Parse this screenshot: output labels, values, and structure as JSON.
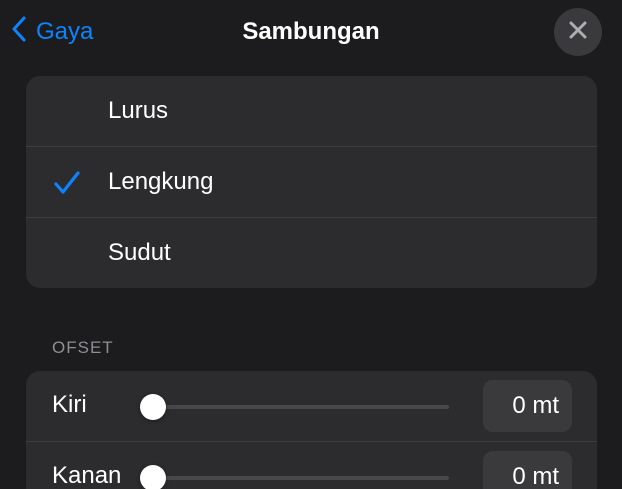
{
  "header": {
    "back_label": "Gaya",
    "title": "Sambungan",
    "close_icon": "close-icon"
  },
  "options": {
    "items": [
      {
        "label": "Lurus",
        "selected": false
      },
      {
        "label": "Lengkung",
        "selected": true
      },
      {
        "label": "Sudut",
        "selected": false
      }
    ]
  },
  "offset": {
    "section_label": "OFSET",
    "rows": [
      {
        "label": "Kiri",
        "value": "0 mt",
        "level": 0
      },
      {
        "label": "Kanan",
        "value": "0 mt",
        "level": 0
      }
    ]
  },
  "colors": {
    "accent": "#0a84ff",
    "background": "#1c1c1e",
    "group_background": "#2c2c2e"
  }
}
